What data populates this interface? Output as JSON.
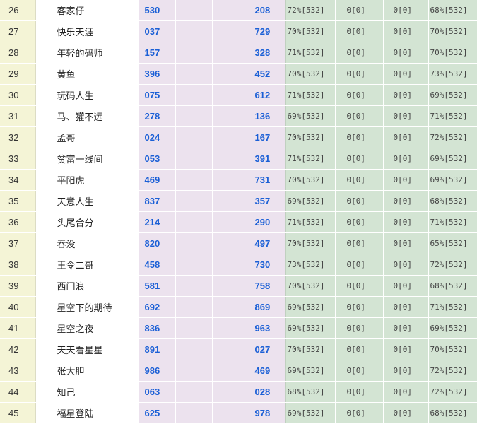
{
  "table": {
    "rows": [
      {
        "rank": "26",
        "name": "客家仔",
        "num1": "530",
        "num2": "208",
        "g1": "72%[532]",
        "g2": "0[0]",
        "g3": "0[0]",
        "g4": "68%[532]"
      },
      {
        "rank": "27",
        "name": "快乐天涯",
        "num1": "037",
        "num2": "729",
        "g1": "70%[532]",
        "g2": "0[0]",
        "g3": "0[0]",
        "g4": "70%[532]"
      },
      {
        "rank": "28",
        "name": "年轻的码师",
        "num1": "157",
        "num2": "328",
        "g1": "71%[532]",
        "g2": "0[0]",
        "g3": "0[0]",
        "g4": "70%[532]"
      },
      {
        "rank": "29",
        "name": "黄鱼",
        "num1": "396",
        "num2": "452",
        "g1": "70%[532]",
        "g2": "0[0]",
        "g3": "0[0]",
        "g4": "73%[532]"
      },
      {
        "rank": "30",
        "name": "玩码人生",
        "num1": "075",
        "num2": "612",
        "g1": "71%[532]",
        "g2": "0[0]",
        "g3": "0[0]",
        "g4": "69%[532]"
      },
      {
        "rank": "31",
        "name": "马、獾不远",
        "num1": "278",
        "num2": "136",
        "g1": "69%[532]",
        "g2": "0[0]",
        "g3": "0[0]",
        "g4": "71%[532]"
      },
      {
        "rank": "32",
        "name": "孟哥",
        "num1": "024",
        "num2": "167",
        "g1": "70%[532]",
        "g2": "0[0]",
        "g3": "0[0]",
        "g4": "72%[532]"
      },
      {
        "rank": "33",
        "name": "贫富一线间",
        "num1": "053",
        "num2": "391",
        "g1": "71%[532]",
        "g2": "0[0]",
        "g3": "0[0]",
        "g4": "69%[532]"
      },
      {
        "rank": "34",
        "name": "平阳虎",
        "num1": "469",
        "num2": "731",
        "g1": "70%[532]",
        "g2": "0[0]",
        "g3": "0[0]",
        "g4": "69%[532]"
      },
      {
        "rank": "35",
        "name": "天意人生",
        "num1": "837",
        "num2": "357",
        "g1": "69%[532]",
        "g2": "0[0]",
        "g3": "0[0]",
        "g4": "68%[532]"
      },
      {
        "rank": "36",
        "name": "头尾合分",
        "num1": "214",
        "num2": "290",
        "g1": "71%[532]",
        "g2": "0[0]",
        "g3": "0[0]",
        "g4": "71%[532]"
      },
      {
        "rank": "37",
        "name": "吞没",
        "num1": "820",
        "num2": "497",
        "g1": "70%[532]",
        "g2": "0[0]",
        "g3": "0[0]",
        "g4": "65%[532]"
      },
      {
        "rank": "38",
        "name": "王令二哥",
        "num1": "458",
        "num2": "730",
        "g1": "73%[532]",
        "g2": "0[0]",
        "g3": "0[0]",
        "g4": "72%[532]"
      },
      {
        "rank": "39",
        "name": "西门浪",
        "num1": "581",
        "num2": "758",
        "g1": "70%[532]",
        "g2": "0[0]",
        "g3": "0[0]",
        "g4": "68%[532]"
      },
      {
        "rank": "40",
        "name": "星空下的期待",
        "num1": "692",
        "num2": "869",
        "g1": "69%[532]",
        "g2": "0[0]",
        "g3": "0[0]",
        "g4": "71%[532]"
      },
      {
        "rank": "41",
        "name": "星空之夜",
        "num1": "836",
        "num2": "963",
        "g1": "69%[532]",
        "g2": "0[0]",
        "g3": "0[0]",
        "g4": "69%[532]"
      },
      {
        "rank": "42",
        "name": "天天看星星",
        "num1": "891",
        "num2": "027",
        "g1": "70%[532]",
        "g2": "0[0]",
        "g3": "0[0]",
        "g4": "70%[532]"
      },
      {
        "rank": "43",
        "name": "张大胆",
        "num1": "986",
        "num2": "469",
        "g1": "69%[532]",
        "g2": "0[0]",
        "g3": "0[0]",
        "g4": "72%[532]"
      },
      {
        "rank": "44",
        "name": "知己",
        "num1": "063",
        "num2": "028",
        "g1": "68%[532]",
        "g2": "0[0]",
        "g3": "0[0]",
        "g4": "72%[532]"
      },
      {
        "rank": "45",
        "name": "福星登陆",
        "num1": "625",
        "num2": "978",
        "g1": "69%[532]",
        "g2": "0[0]",
        "g3": "0[0]",
        "g4": "68%[532]"
      }
    ]
  }
}
